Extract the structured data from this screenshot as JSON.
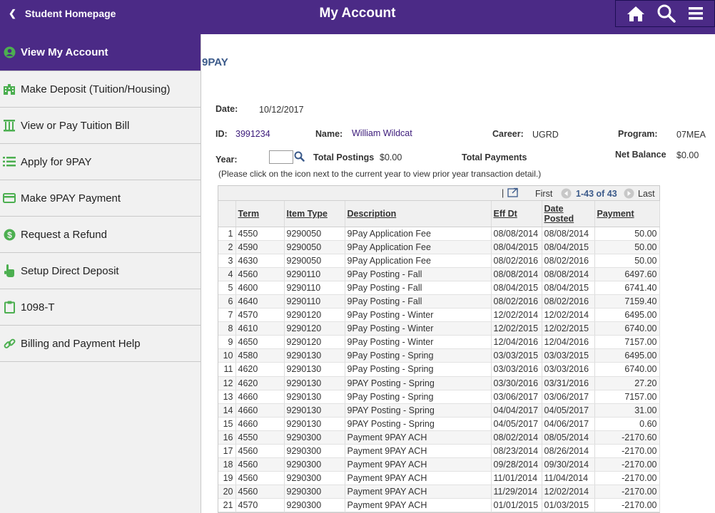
{
  "header": {
    "back_label": "Student Homepage",
    "title": "My Account"
  },
  "colors": {
    "brand_purple": "#4b2a86",
    "link_blue": "#3b5a8a",
    "icon_green": "#4caf50"
  },
  "sidebar": {
    "items": [
      {
        "label": "View My Account",
        "icon": "person-icon",
        "active": true
      },
      {
        "label": "Make Deposit (Tuition/Housing)",
        "icon": "building-icon"
      },
      {
        "label": "View or Pay Tuition Bill",
        "icon": "pillar-icon"
      },
      {
        "label": "Apply for 9PAY",
        "icon": "list-icon"
      },
      {
        "label": "Make 9PAY Payment",
        "icon": "credit-card-icon"
      },
      {
        "label": "Request a Refund",
        "icon": "dollar-icon"
      },
      {
        "label": "Setup Direct Deposit",
        "icon": "hand-pointer-icon"
      },
      {
        "label": "1098-T",
        "icon": "clipboard-icon"
      },
      {
        "label": "Billing and Payment Help",
        "icon": "link-icon"
      }
    ]
  },
  "main": {
    "page_title": "9PAY",
    "date_label": "Date:",
    "date_value": "10/12/2017",
    "id_label": "ID:",
    "id_value": "3991234",
    "name_label": "Name:",
    "name_value": "William Wildcat",
    "career_label": "Career:",
    "career_value": "UGRD",
    "program_label": "Program:",
    "program_value": "07MEA",
    "year_label": "Year:",
    "year_value": "",
    "total_postings_label": "Total Postings",
    "total_postings_value": "$0.00",
    "total_payments_label": "Total Payments",
    "net_balance_label": "Net Balance",
    "net_balance_value": "$0.00",
    "note": "(Please click on the icon next to the current year to view prior year transaction detail.)"
  },
  "grid": {
    "first_label": "First",
    "range_label": "1-43 of 43",
    "last_label": "Last",
    "columns": [
      "",
      "Term",
      "Item Type",
      "Description",
      "Eff Dt",
      "Date Posted",
      "Payment"
    ],
    "rows": [
      [
        "1",
        "4550",
        "9290050",
        "9Pay Application Fee",
        "08/08/2014",
        "08/08/2014",
        "50.00"
      ],
      [
        "2",
        "4590",
        "9290050",
        "9Pay Application Fee",
        "08/04/2015",
        "08/04/2015",
        "50.00"
      ],
      [
        "3",
        "4630",
        "9290050",
        "9Pay Application Fee",
        "08/02/2016",
        "08/02/2016",
        "50.00"
      ],
      [
        "4",
        "4560",
        "9290110",
        "9Pay Posting - Fall",
        "08/08/2014",
        "08/08/2014",
        "6497.60"
      ],
      [
        "5",
        "4600",
        "9290110",
        "9Pay Posting - Fall",
        "08/04/2015",
        "08/04/2015",
        "6741.40"
      ],
      [
        "6",
        "4640",
        "9290110",
        "9Pay Posting - Fall",
        "08/02/2016",
        "08/02/2016",
        "7159.40"
      ],
      [
        "7",
        "4570",
        "9290120",
        "9Pay Posting - Winter",
        "12/02/2014",
        "12/02/2014",
        "6495.00"
      ],
      [
        "8",
        "4610",
        "9290120",
        "9Pay Posting - Winter",
        "12/02/2015",
        "12/02/2015",
        "6740.00"
      ],
      [
        "9",
        "4650",
        "9290120",
        "9Pay Posting - Winter",
        "12/04/2016",
        "12/04/2016",
        "7157.00"
      ],
      [
        "10",
        "4580",
        "9290130",
        "9Pay Posting - Spring",
        "03/03/2015",
        "03/03/2015",
        "6495.00"
      ],
      [
        "11",
        "4620",
        "9290130",
        "9Pay Posting - Spring",
        "03/03/2016",
        "03/03/2016",
        "6740.00"
      ],
      [
        "12",
        "4620",
        "9290130",
        "9PAY Posting - Spring",
        "03/30/2016",
        "03/31/2016",
        "27.20"
      ],
      [
        "13",
        "4660",
        "9290130",
        "9Pay Posting - Spring",
        "03/06/2017",
        "03/06/2017",
        "7157.00"
      ],
      [
        "14",
        "4660",
        "9290130",
        "9PAY Posting - Spring",
        "04/04/2017",
        "04/05/2017",
        "31.00"
      ],
      [
        "15",
        "4660",
        "9290130",
        "9PAY Posting - Spring",
        "04/05/2017",
        "04/06/2017",
        "0.60"
      ],
      [
        "16",
        "4550",
        "9290300",
        "Payment 9PAY ACH",
        "08/02/2014",
        "08/05/2014",
        "-2170.60"
      ],
      [
        "17",
        "4560",
        "9290300",
        "Payment 9PAY ACH",
        "08/23/2014",
        "08/26/2014",
        "-2170.00"
      ],
      [
        "18",
        "4560",
        "9290300",
        "Payment 9PAY ACH",
        "09/28/2014",
        "09/30/2014",
        "-2170.00"
      ],
      [
        "19",
        "4560",
        "9290300",
        "Payment 9PAY ACH",
        "11/01/2014",
        "11/04/2014",
        "-2170.00"
      ],
      [
        "20",
        "4560",
        "9290300",
        "Payment 9PAY ACH",
        "11/29/2014",
        "12/02/2014",
        "-2170.00"
      ],
      [
        "21",
        "4570",
        "9290300",
        "Payment 9PAY ACH",
        "01/01/2015",
        "01/03/2015",
        "-2170.00"
      ]
    ]
  }
}
